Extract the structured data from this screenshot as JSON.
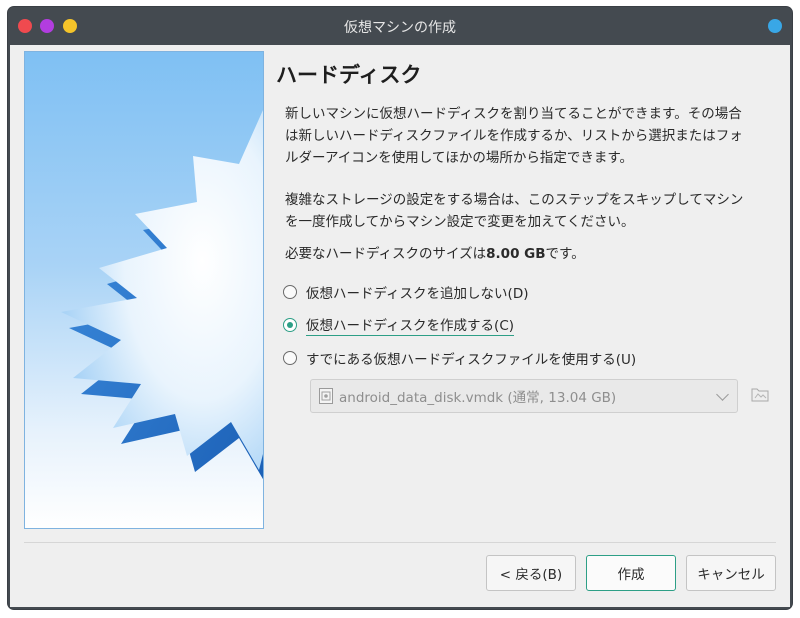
{
  "window": {
    "title": "仮想マシンの作成",
    "controls": {
      "close_color": "#f04a4f",
      "minimize_color": "#b23de0",
      "maximize_color": "#f5c42a",
      "indicator_color": "#39a7e6"
    }
  },
  "page": {
    "heading": "ハードディスク",
    "paragraph1_line1": "新しいマシンに仮想ハードディスクを割り当てることができます。その場合",
    "paragraph1_line2": "は新しいハードディスクファイルを作成するか、リストから選択またはフォ",
    "paragraph1_line3": "ルダーアイコンを使用してほかの場所から指定できます。",
    "paragraph2_line1": "複雑なストレージの設定をする場合は、このステップをスキップしてマシン",
    "paragraph2_line2": "を一度作成してからマシン設定で変更を加えてください。",
    "size_prefix": "必要なハードディスクのサイズは",
    "size_value": "8.00 GB",
    "size_suffix": "です。"
  },
  "options": [
    {
      "label": "仮想ハードディスクを追加しない(D)",
      "checked": false
    },
    {
      "label": "仮想ハードディスクを作成する(C)",
      "checked": true
    },
    {
      "label": "すでにある仮想ハードディスクファイルを使用する(U)",
      "checked": false
    }
  ],
  "existing_disk": {
    "selected": "android_data_disk.vmdk (通常, 13.04 GB)",
    "icon": "hard-disk-file-icon",
    "browse_icon": "folder-icon"
  },
  "buttons": {
    "back": "< 戻る(B)",
    "create": "作成",
    "cancel": "キャンセル"
  },
  "colors": {
    "accent": "#2d9f86",
    "titlebar": "#444a50",
    "image_blue": "#7fc0f3"
  }
}
